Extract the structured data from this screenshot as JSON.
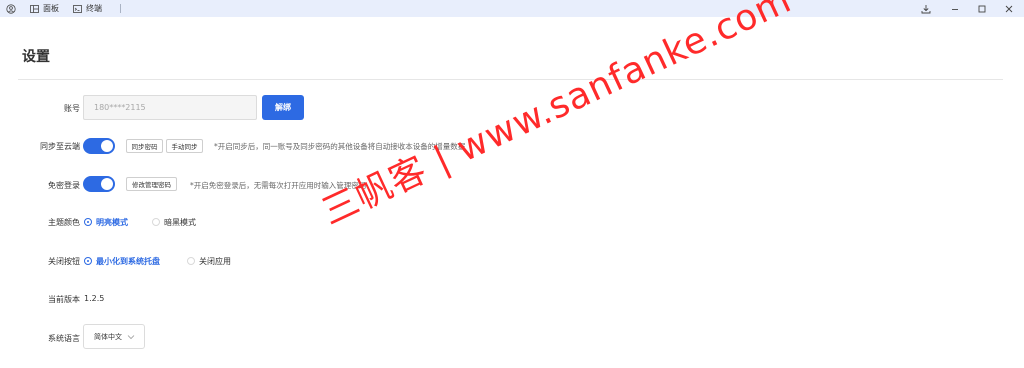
{
  "titlebar": {
    "tabs": [
      {
        "label": "面板",
        "icon": "panel-icon"
      },
      {
        "label": "终端",
        "icon": "terminal-icon"
      }
    ],
    "controls": [
      "download-icon",
      "minimize-icon",
      "maximize-icon",
      "close-icon"
    ]
  },
  "page": {
    "title": "设置"
  },
  "account": {
    "label": "账号",
    "value": "180****2115",
    "unbind_label": "解绑"
  },
  "sync": {
    "label": "同步至云端",
    "enabled": true,
    "btn_sync_password": "同步密码",
    "btn_manual_sync": "手动同步",
    "hint": "*开启同步后，同一账号及同步密码的其他设备将自动接收本设备的增量数据"
  },
  "passwordless": {
    "label": "免密登录",
    "enabled": true,
    "btn_change_password": "修改管理密码",
    "hint": "*开启免密登录后，无需每次打开应用时输入管理密码"
  },
  "theme": {
    "label": "主题颜色",
    "options": [
      {
        "label": "明亮模式",
        "selected": true
      },
      {
        "label": "暗黑模式",
        "selected": false
      }
    ]
  },
  "close_button": {
    "label": "关闭按钮",
    "options": [
      {
        "label": "最小化到系统托盘",
        "selected": true
      },
      {
        "label": "关闭应用",
        "selected": false
      }
    ]
  },
  "version": {
    "label": "当前版本",
    "value": "1.2.5"
  },
  "language": {
    "label": "系统语言",
    "value": "简体中文"
  },
  "watermark": {
    "text": "三帆客 | www.sanfanke.com"
  },
  "colors": {
    "accent": "#2d6ae3",
    "titlebar_bg": "#e8eefc",
    "watermark": "#ff2a2a"
  }
}
